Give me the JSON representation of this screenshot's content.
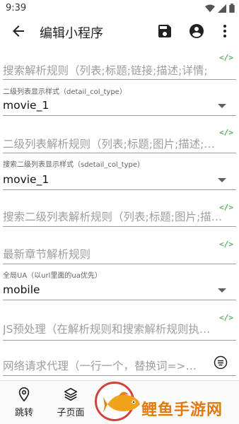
{
  "status_bar": {
    "time": "9:39"
  },
  "app_bar": {
    "title": "编辑小程序"
  },
  "code_badge": "</>",
  "fields": {
    "search_rule_hint": "搜索解析规则（列表;标题;链接;描述;详情;",
    "detail_col_type_label": "二级列表显示样式（detail_col_type）",
    "detail_col_type_value": "movie_1",
    "detail_rule_hint": "二级列表解析规则（列表;标题;图片;描述;…",
    "sdetail_col_type_label": "搜索二级列表显示样式（sdetail_col_type）",
    "sdetail_col_type_value": "movie_1",
    "sdetail_rule_hint": "搜索二级列表解析规则（列表;标题;图片;描…",
    "latest_chapter_hint": "最新章节解析规则",
    "ua_label": "全局UA（以url里面的ua优先）",
    "ua_value": "mobile",
    "js_preprocess_hint": "JS预处理（在解析规则和搜索解析规则执…",
    "proxy_hint": "网络请求代理（一行一个，替换词=>…"
  },
  "bottom_nav": {
    "items": [
      {
        "label": "跳转",
        "icon": "location-pin-icon"
      },
      {
        "label": "子页面",
        "icon": "layers-icon"
      }
    ]
  },
  "watermark": {
    "text": "鲤鱼手游网"
  },
  "colors": {
    "code_badge": "#2e9c3a",
    "watermark": "#e07b12",
    "watermark_circle": "#d0443a"
  }
}
